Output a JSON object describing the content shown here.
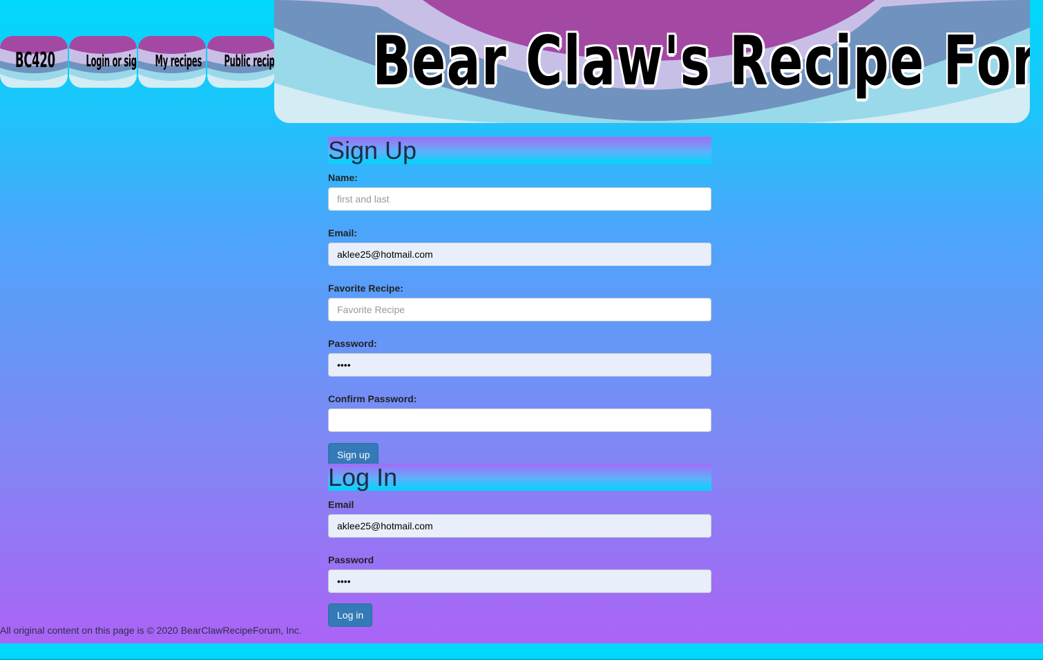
{
  "nav": {
    "items": [
      {
        "label": "BC420"
      },
      {
        "label": "Login or sign up"
      },
      {
        "label": "My recipes"
      },
      {
        "label": "Public recipes"
      }
    ]
  },
  "banner": {
    "title": "Bear Claw's Recipe Forum"
  },
  "signup": {
    "heading": "Sign Up",
    "name_label": "Name:",
    "name_placeholder": "first and last",
    "name_value": "",
    "email_label": "Email:",
    "email_value": "aklee25@hotmail.com",
    "recipe_label": "Favorite Recipe:",
    "recipe_placeholder": "Favorite Recipe",
    "recipe_value": "",
    "password_label": "Password:",
    "password_value": "••••",
    "confirm_label": "Confirm Password:",
    "confirm_value": "",
    "button_label": "Sign up"
  },
  "login": {
    "heading": "Log In",
    "email_label": "Email",
    "email_value": "aklee25@hotmail.com",
    "password_label": "Password",
    "password_value": "••••",
    "button_label": "Log in"
  },
  "footer": {
    "text": "All original content on this page is © 2020 BearClawRecipeForum, Inc."
  },
  "colors": {
    "accent_cyan": "#00d8fb",
    "gradient_top": "#1fc3fb",
    "gradient_bottom": "#ab64f6",
    "button_blue": "#337ab7",
    "wave_magenta": "#a349a4",
    "wave_lavender": "#c8bfe7",
    "wave_slate": "#7092be",
    "wave_light_blue": "#99d9ea",
    "wave_pale": "#d4ecf3"
  }
}
